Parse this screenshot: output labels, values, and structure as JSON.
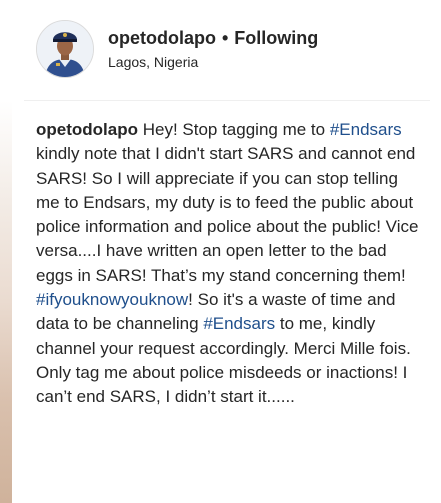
{
  "post": {
    "username": "opetodolapo",
    "separator": "•",
    "follow_state": "Following",
    "location": "Lagos, Nigeria",
    "avatar_icon": "profile-photo-police-officer",
    "caption": {
      "username": "opetodolapo",
      "segments": [
        {
          "type": "text",
          "value": " Hey! Stop tagging me to "
        },
        {
          "type": "hashtag",
          "value": "#Endsars"
        },
        {
          "type": "text",
          "value": " kindly note that I didn't start SARS and cannot end SARS! So I will appreciate if you can stop telling me to Endsars, my duty is to feed the public about police information and police about the public! Vice versa....I have written an open letter to the bad eggs in SARS! That’s my stand concerning them! "
        },
        {
          "type": "hashtag",
          "value": "#ifyouknowyouknow"
        },
        {
          "type": "text",
          "value": "! So it's a waste of time and data to be channeling "
        },
        {
          "type": "hashtag",
          "value": "#Endsars"
        },
        {
          "type": "text",
          "value": " to me, kindly channel your request accordingly. Merci Mille fois. Only tag me about police misdeeds or inactions! I can’t end SARS, I didn’t start it......"
        }
      ]
    }
  },
  "colors": {
    "text": "#262626",
    "hashtag": "#1f4f8c",
    "divider": "#efefef"
  }
}
